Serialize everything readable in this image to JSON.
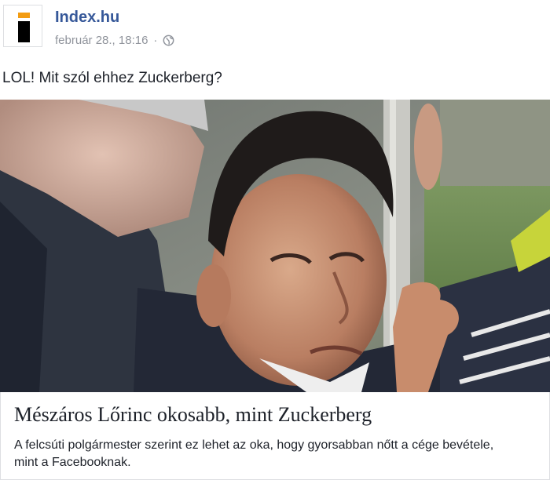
{
  "post": {
    "page_name": "Index.hu",
    "timestamp": "február 28., 18:16",
    "separator": "·",
    "privacy_icon": "globe-icon",
    "text": "LOL! Mit szól ehhez Zuckerberg?"
  },
  "link_preview": {
    "image_description": "photo",
    "title": "Mészáros Lőrinc okosabb, mint Zuckerberg",
    "description": "A felcsúti polgármester szerint ez lehet az oka, hogy gyorsabban nőtt a cége bevétele, mint a Facebooknak."
  },
  "colors": {
    "link_blue": "#365899",
    "meta_gray": "#90949c",
    "logo_orange": "#f39c12"
  }
}
